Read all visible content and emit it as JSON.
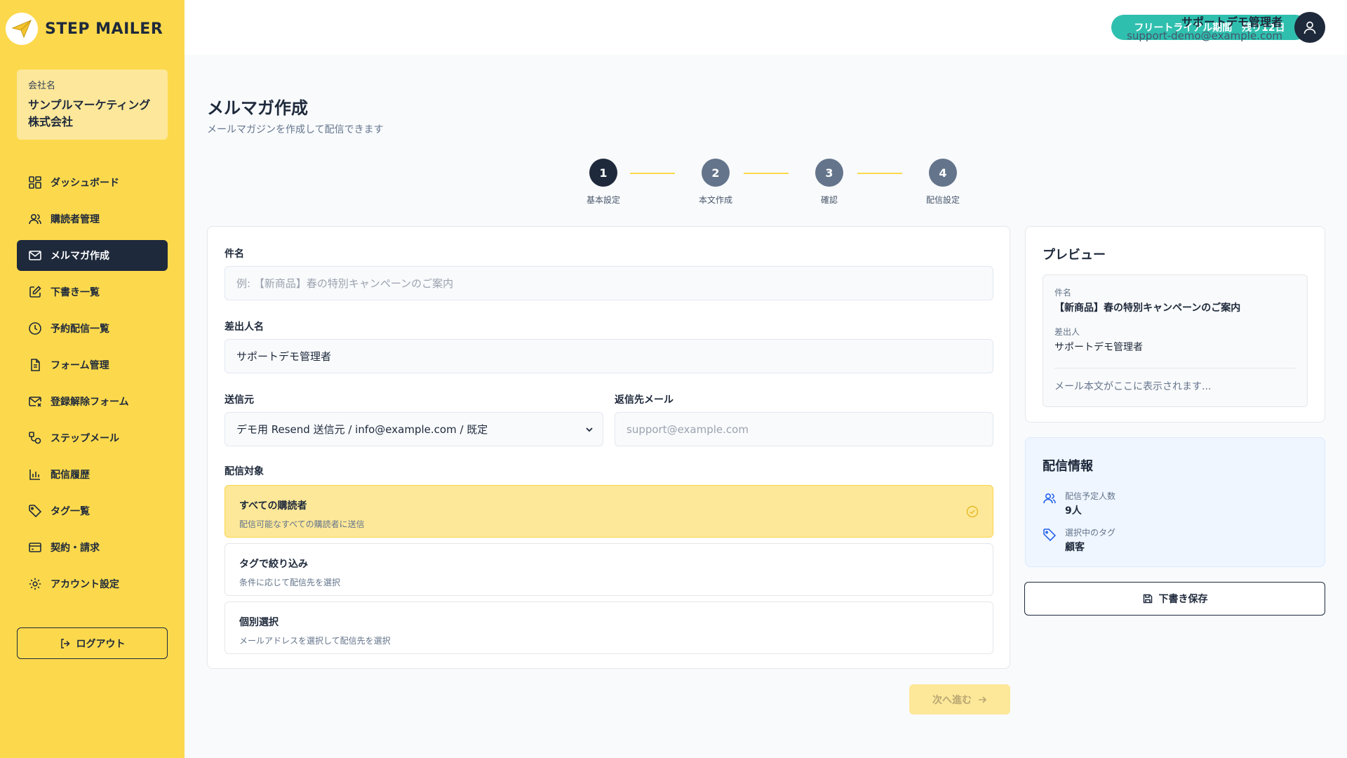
{
  "app": {
    "name": "STEP MAILER"
  },
  "company": {
    "label": "会社名",
    "name": "サンプルマーケティング株式会社"
  },
  "sidebar": {
    "items": [
      {
        "label": "ダッシュボード",
        "icon": "dashboard-icon"
      },
      {
        "label": "購読者管理",
        "icon": "users-icon"
      },
      {
        "label": "メルマガ作成",
        "icon": "mail-icon",
        "active": true
      },
      {
        "label": "下書き一覧",
        "icon": "draft-edit-icon"
      },
      {
        "label": "予約配信一覧",
        "icon": "clock-icon"
      },
      {
        "label": "フォーム管理",
        "icon": "document-icon"
      },
      {
        "label": "登録解除フォーム",
        "icon": "mail-x-icon"
      },
      {
        "label": "ステップメール",
        "icon": "workflow-icon"
      },
      {
        "label": "配信履歴",
        "icon": "bar-chart-icon"
      },
      {
        "label": "タグ一覧",
        "icon": "tag-icon"
      },
      {
        "label": "契約・請求",
        "icon": "credit-card-icon"
      },
      {
        "label": "アカウント設定",
        "icon": "gear-icon"
      }
    ],
    "logout_label": "ログアウト"
  },
  "header": {
    "trial_badge": "フリートライアル期間　残り12日",
    "user_name": "サポートデモ管理者",
    "user_email": "support-demo@example.com"
  },
  "page": {
    "title": "メルマガ作成",
    "subtitle": "メールマガジンを作成して配信できます"
  },
  "steps": [
    {
      "number": "1",
      "label": "基本設定",
      "active": true
    },
    {
      "number": "2",
      "label": "本文作成"
    },
    {
      "number": "3",
      "label": "確認"
    },
    {
      "number": "4",
      "label": "配信設定"
    }
  ],
  "form": {
    "subject_label": "件名",
    "subject_placeholder": "例: 【新商品】春の特別キャンペーンのご案内",
    "sender_name_label": "差出人名",
    "sender_name_value": "サポートデモ管理者",
    "from_label": "送信元",
    "from_value": "デモ用 Resend 送信元 / info@example.com / 既定",
    "reply_label": "返信先メール",
    "reply_placeholder": "support@example.com",
    "target_label": "配信対象",
    "targets": [
      {
        "title": "すべての購読者",
        "desc": "配信可能なすべての購読者に送信",
        "selected": true
      },
      {
        "title": "タグで絞り込み",
        "desc": "条件に応じて配信先を選択"
      },
      {
        "title": "個別選択",
        "desc": "メールアドレスを選択して配信先を選択"
      }
    ],
    "next_label": "次へ進む"
  },
  "preview": {
    "title": "プレビュー",
    "subject_label": "件名",
    "subject_value": "【新商品】春の特別キャンペーンのご案内",
    "sender_label": "差出人",
    "sender_value": "サポートデモ管理者",
    "body_placeholder": "メール本文がここに表示されます..."
  },
  "delivery": {
    "title": "配信情報",
    "count_label": "配信予定人数",
    "count_value": "9人",
    "tag_label": "選択中のタグ",
    "tag_value": "顧客"
  },
  "draft_save_label": "下書き保存",
  "colors": {
    "brand_yellow": "#fcd94c",
    "dark": "#1e293b",
    "teal": "#2fbfae"
  }
}
